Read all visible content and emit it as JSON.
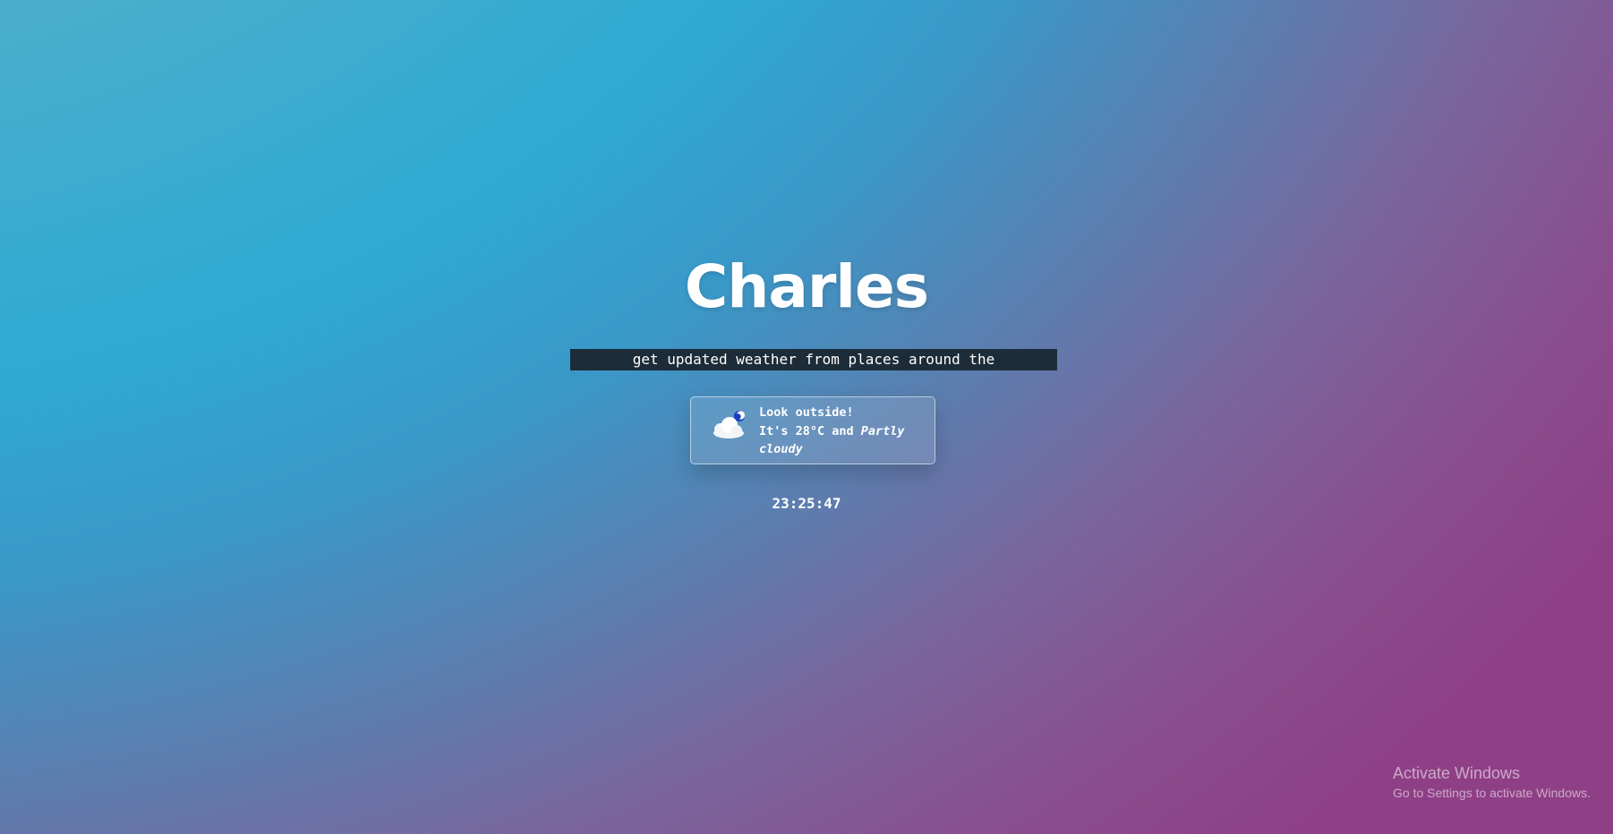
{
  "header": {
    "title": "Charles"
  },
  "ticker": {
    "text": "get updated weather from places around the"
  },
  "weather_card": {
    "icon": "partly-cloudy-night-icon",
    "greeting": "Look outside!",
    "prefix": "It's ",
    "temperature": "28°C",
    "connector": " and ",
    "condition": "Partly cloudy"
  },
  "clock": {
    "time": "23:25:47"
  },
  "watermark": {
    "title": "Activate Windows",
    "subtitle": "Go to Settings to activate Windows."
  }
}
